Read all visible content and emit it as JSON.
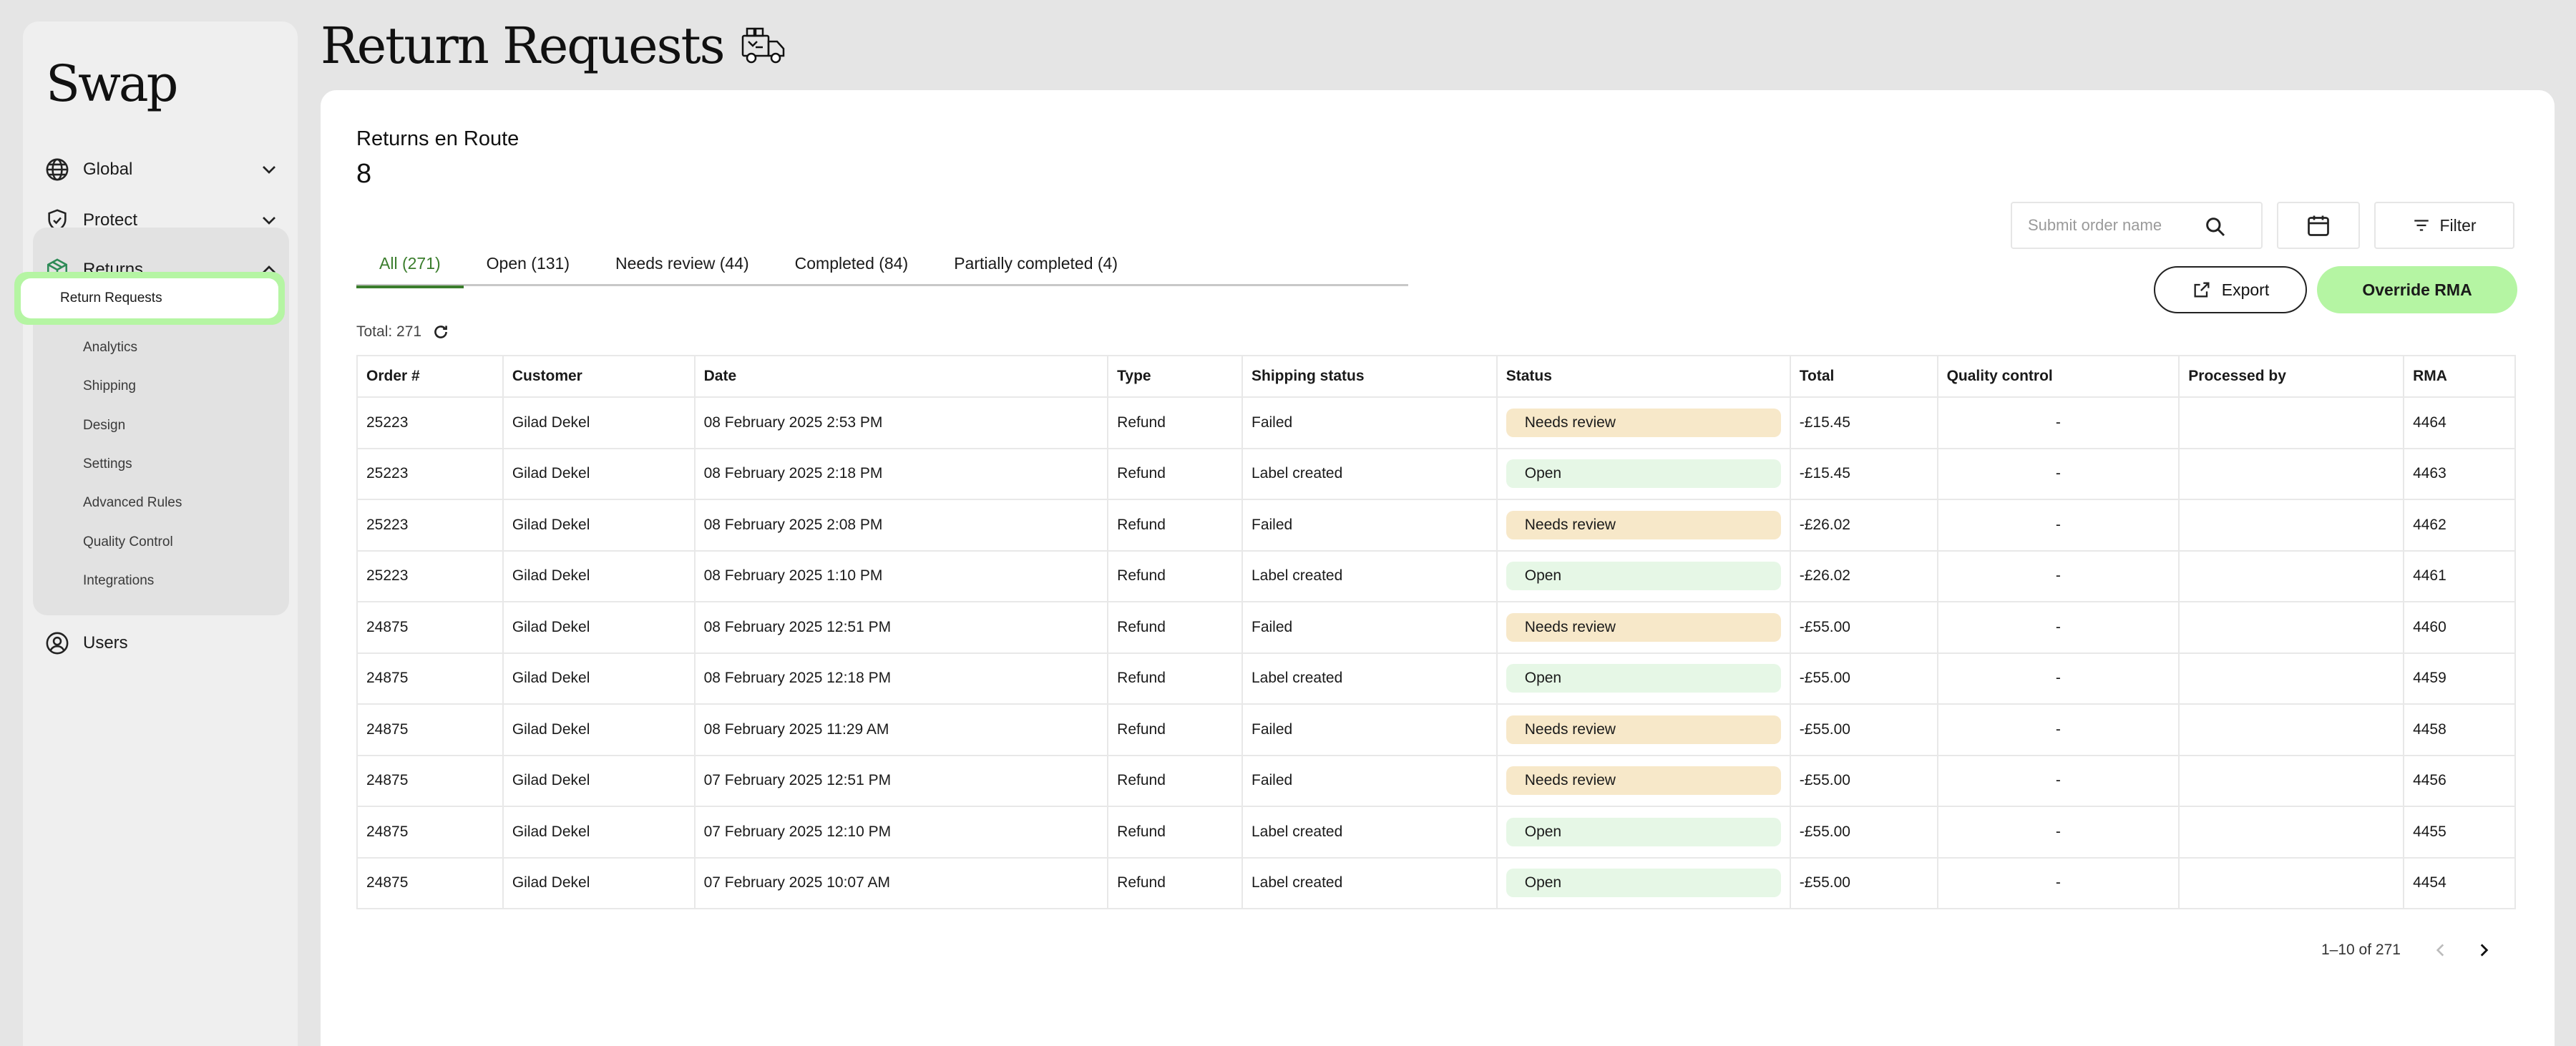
{
  "app": {
    "logo": "Swap"
  },
  "sidebar": {
    "global_label": "Global",
    "protect_label": "Protect",
    "returns_label": "Returns",
    "returns_items": [
      {
        "label": "Return Requests"
      },
      {
        "label": "Analytics"
      },
      {
        "label": "Shipping"
      },
      {
        "label": "Design"
      },
      {
        "label": "Settings"
      },
      {
        "label": "Advanced Rules"
      },
      {
        "label": "Quality Control"
      },
      {
        "label": "Integrations"
      }
    ],
    "users_label": "Users"
  },
  "page": {
    "title": "Return Requests"
  },
  "summary": {
    "title": "Returns en Route",
    "count": "8"
  },
  "tabs": [
    {
      "label": "All (271)",
      "active": true
    },
    {
      "label": "Open (131)"
    },
    {
      "label": "Needs review (44)"
    },
    {
      "label": "Completed (84)"
    },
    {
      "label": "Partially completed (4)"
    }
  ],
  "search": {
    "placeholder": "Submit order name",
    "value": ""
  },
  "toolbar": {
    "filter_label": "Filter",
    "export_label": "Export",
    "override_label": "Override RMA"
  },
  "total": {
    "label": "Total: 271"
  },
  "table": {
    "headers": [
      "Order #",
      "Customer",
      "Date",
      "Type",
      "Shipping status",
      "Status",
      "Total",
      "Quality control",
      "Processed by",
      "RMA"
    ],
    "rows": [
      {
        "order": "25223",
        "customer": "Gilad Dekel",
        "date": "08 February 2025 2:53 PM",
        "type": "Refund",
        "shipping": "Failed",
        "status": "Needs review",
        "total": "-£15.45",
        "qc": "-",
        "processed_by": "",
        "rma": "4464"
      },
      {
        "order": "25223",
        "customer": "Gilad Dekel",
        "date": "08 February 2025 2:18 PM",
        "type": "Refund",
        "shipping": "Label created",
        "status": "Open",
        "total": "-£15.45",
        "qc": "-",
        "processed_by": "",
        "rma": "4463"
      },
      {
        "order": "25223",
        "customer": "Gilad Dekel",
        "date": "08 February 2025 2:08 PM",
        "type": "Refund",
        "shipping": "Failed",
        "status": "Needs review",
        "total": "-£26.02",
        "qc": "-",
        "processed_by": "",
        "rma": "4462"
      },
      {
        "order": "25223",
        "customer": "Gilad Dekel",
        "date": "08 February 2025 1:10 PM",
        "type": "Refund",
        "shipping": "Label created",
        "status": "Open",
        "total": "-£26.02",
        "qc": "-",
        "processed_by": "",
        "rma": "4461"
      },
      {
        "order": "24875",
        "customer": "Gilad Dekel",
        "date": "08 February 2025 12:51 PM",
        "type": "Refund",
        "shipping": "Failed",
        "status": "Needs review",
        "total": "-£55.00",
        "qc": "-",
        "processed_by": "",
        "rma": "4460"
      },
      {
        "order": "24875",
        "customer": "Gilad Dekel",
        "date": "08 February 2025 12:18 PM",
        "type": "Refund",
        "shipping": "Label created",
        "status": "Open",
        "total": "-£55.00",
        "qc": "-",
        "processed_by": "",
        "rma": "4459"
      },
      {
        "order": "24875",
        "customer": "Gilad Dekel",
        "date": "08 February 2025 11:29 AM",
        "type": "Refund",
        "shipping": "Failed",
        "status": "Needs review",
        "total": "-£55.00",
        "qc": "-",
        "processed_by": "",
        "rma": "4458"
      },
      {
        "order": "24875",
        "customer": "Gilad Dekel",
        "date": "07 February 2025 12:51 PM",
        "type": "Refund",
        "shipping": "Failed",
        "status": "Needs review",
        "total": "-£55.00",
        "qc": "-",
        "processed_by": "",
        "rma": "4456"
      },
      {
        "order": "24875",
        "customer": "Gilad Dekel",
        "date": "07 February 2025 12:10 PM",
        "type": "Refund",
        "shipping": "Label created",
        "status": "Open",
        "total": "-£55.00",
        "qc": "-",
        "processed_by": "",
        "rma": "4455"
      },
      {
        "order": "24875",
        "customer": "Gilad Dekel",
        "date": "07 February 2025 10:07 AM",
        "type": "Refund",
        "shipping": "Label created",
        "status": "Open",
        "total": "-£55.00",
        "qc": "-",
        "processed_by": "",
        "rma": "4454"
      }
    ]
  },
  "pagination": {
    "label": "1–10 of 271"
  },
  "colors": {
    "accent_green": "#b5f5a3",
    "active_tab": "#3a7d2c",
    "needs_review_bg": "#f7e8c9",
    "open_bg": "#e6f7e6"
  },
  "icons": [
    "globe-icon",
    "shield-check-icon",
    "box-icon",
    "user-circle-icon",
    "chevron-down-icon",
    "chevron-up-icon",
    "truck-icon",
    "search-icon",
    "calendar-icon",
    "filter-icon",
    "external-link-icon",
    "refresh-icon",
    "chevron-left-icon",
    "chevron-right-icon"
  ]
}
